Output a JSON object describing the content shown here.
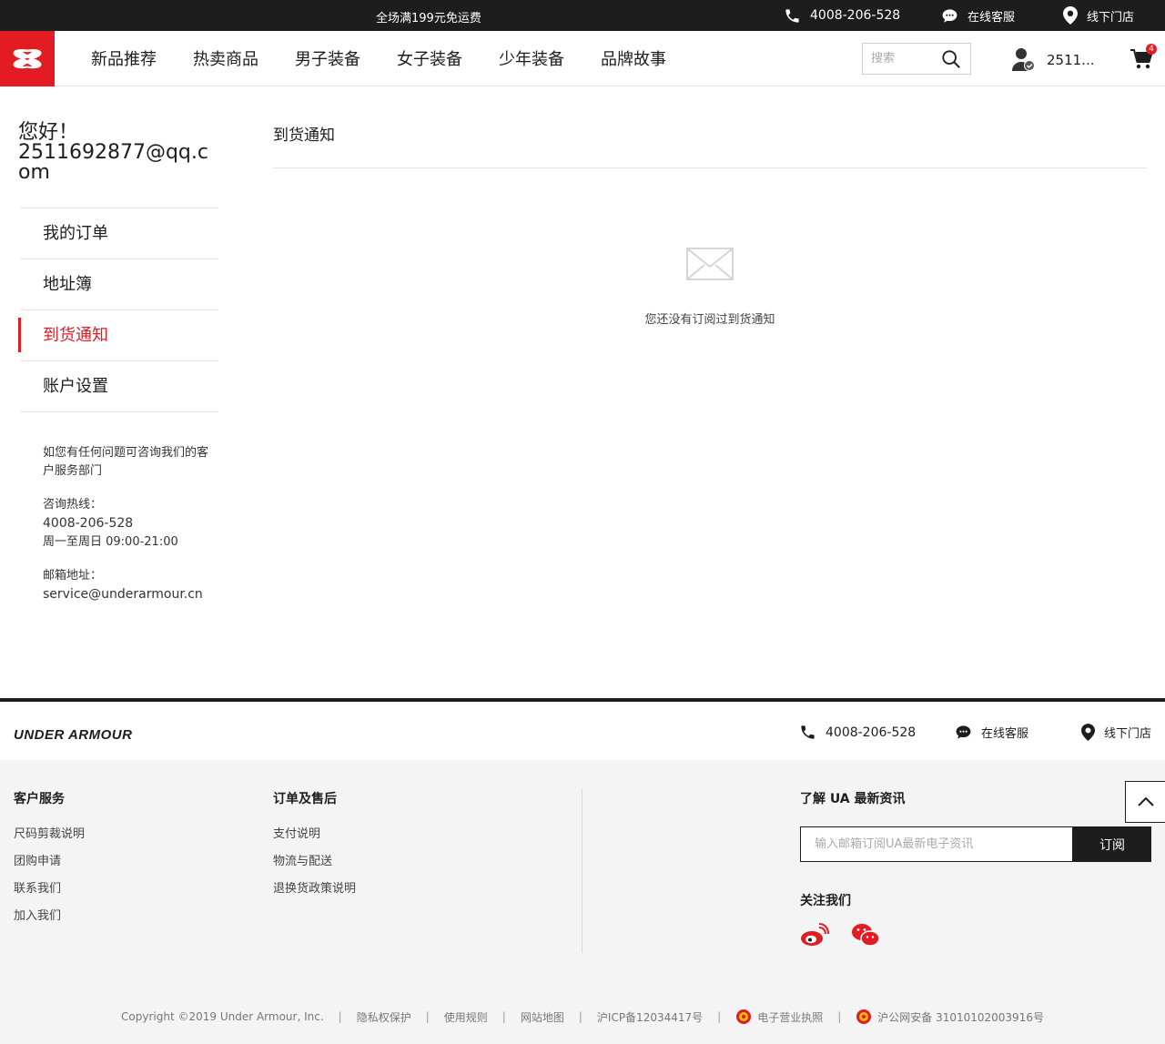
{
  "topbar": {
    "promo": "全场满199元免运费",
    "phone": "4008-206-528",
    "chat": "在线客服",
    "store": "线下门店"
  },
  "header": {
    "nav": [
      "新品推荐",
      "热卖商品",
      "男子装备",
      "女子装备",
      "少年装备",
      "品牌故事"
    ],
    "search_placeholder": "搜索",
    "username": "2511...",
    "cart_count": "4"
  },
  "sidebar": {
    "greeting_line1": "您好！",
    "greeting_email": "2511692877@qq.com",
    "items": [
      {
        "label": "我的订单"
      },
      {
        "label": "地址簿"
      },
      {
        "label": "到货通知",
        "active": true
      },
      {
        "label": "账户设置"
      }
    ],
    "help": {
      "intro": "如您有任何问题可咨询我们的客户服务部门",
      "hotline_label": "咨询热线：",
      "hotline": "4008-206-528",
      "hours": "周一至周日 09:00-21:00",
      "email_label": "邮箱地址：",
      "email": "service@underarmour.cn"
    }
  },
  "main": {
    "title": "到货通知",
    "empty_text": "您还没有订阅过到货通知"
  },
  "footer": {
    "logo_text": "UNDER ARMOUR",
    "phone": "4008-206-528",
    "chat": "在线客服",
    "store": "线下门店",
    "col1": {
      "title": "客户服务",
      "links": [
        "尺码剪裁说明",
        "团购申请",
        "联系我们",
        "加入我们"
      ]
    },
    "col2": {
      "title": "订单及售后",
      "links": [
        "支付说明",
        "物流与配送",
        "退换货政策说明"
      ]
    },
    "subscribe_title": "了解 UA 最新资讯",
    "subscribe_placeholder": "输入邮箱订阅UA最新电子资讯",
    "subscribe_button": "订阅",
    "follow_title": "关注我们",
    "copyright": "Copyright ©2019 Under Armour, Inc.",
    "links": [
      "隐私权保护",
      "使用规则",
      "网站地图"
    ],
    "icp": "沪ICP备12034417号",
    "license": "电子营业执照",
    "police": "沪公网安备 31010102003916号"
  },
  "colors": {
    "brand_red": "#e31b23",
    "dark": "#1d1d1d"
  }
}
